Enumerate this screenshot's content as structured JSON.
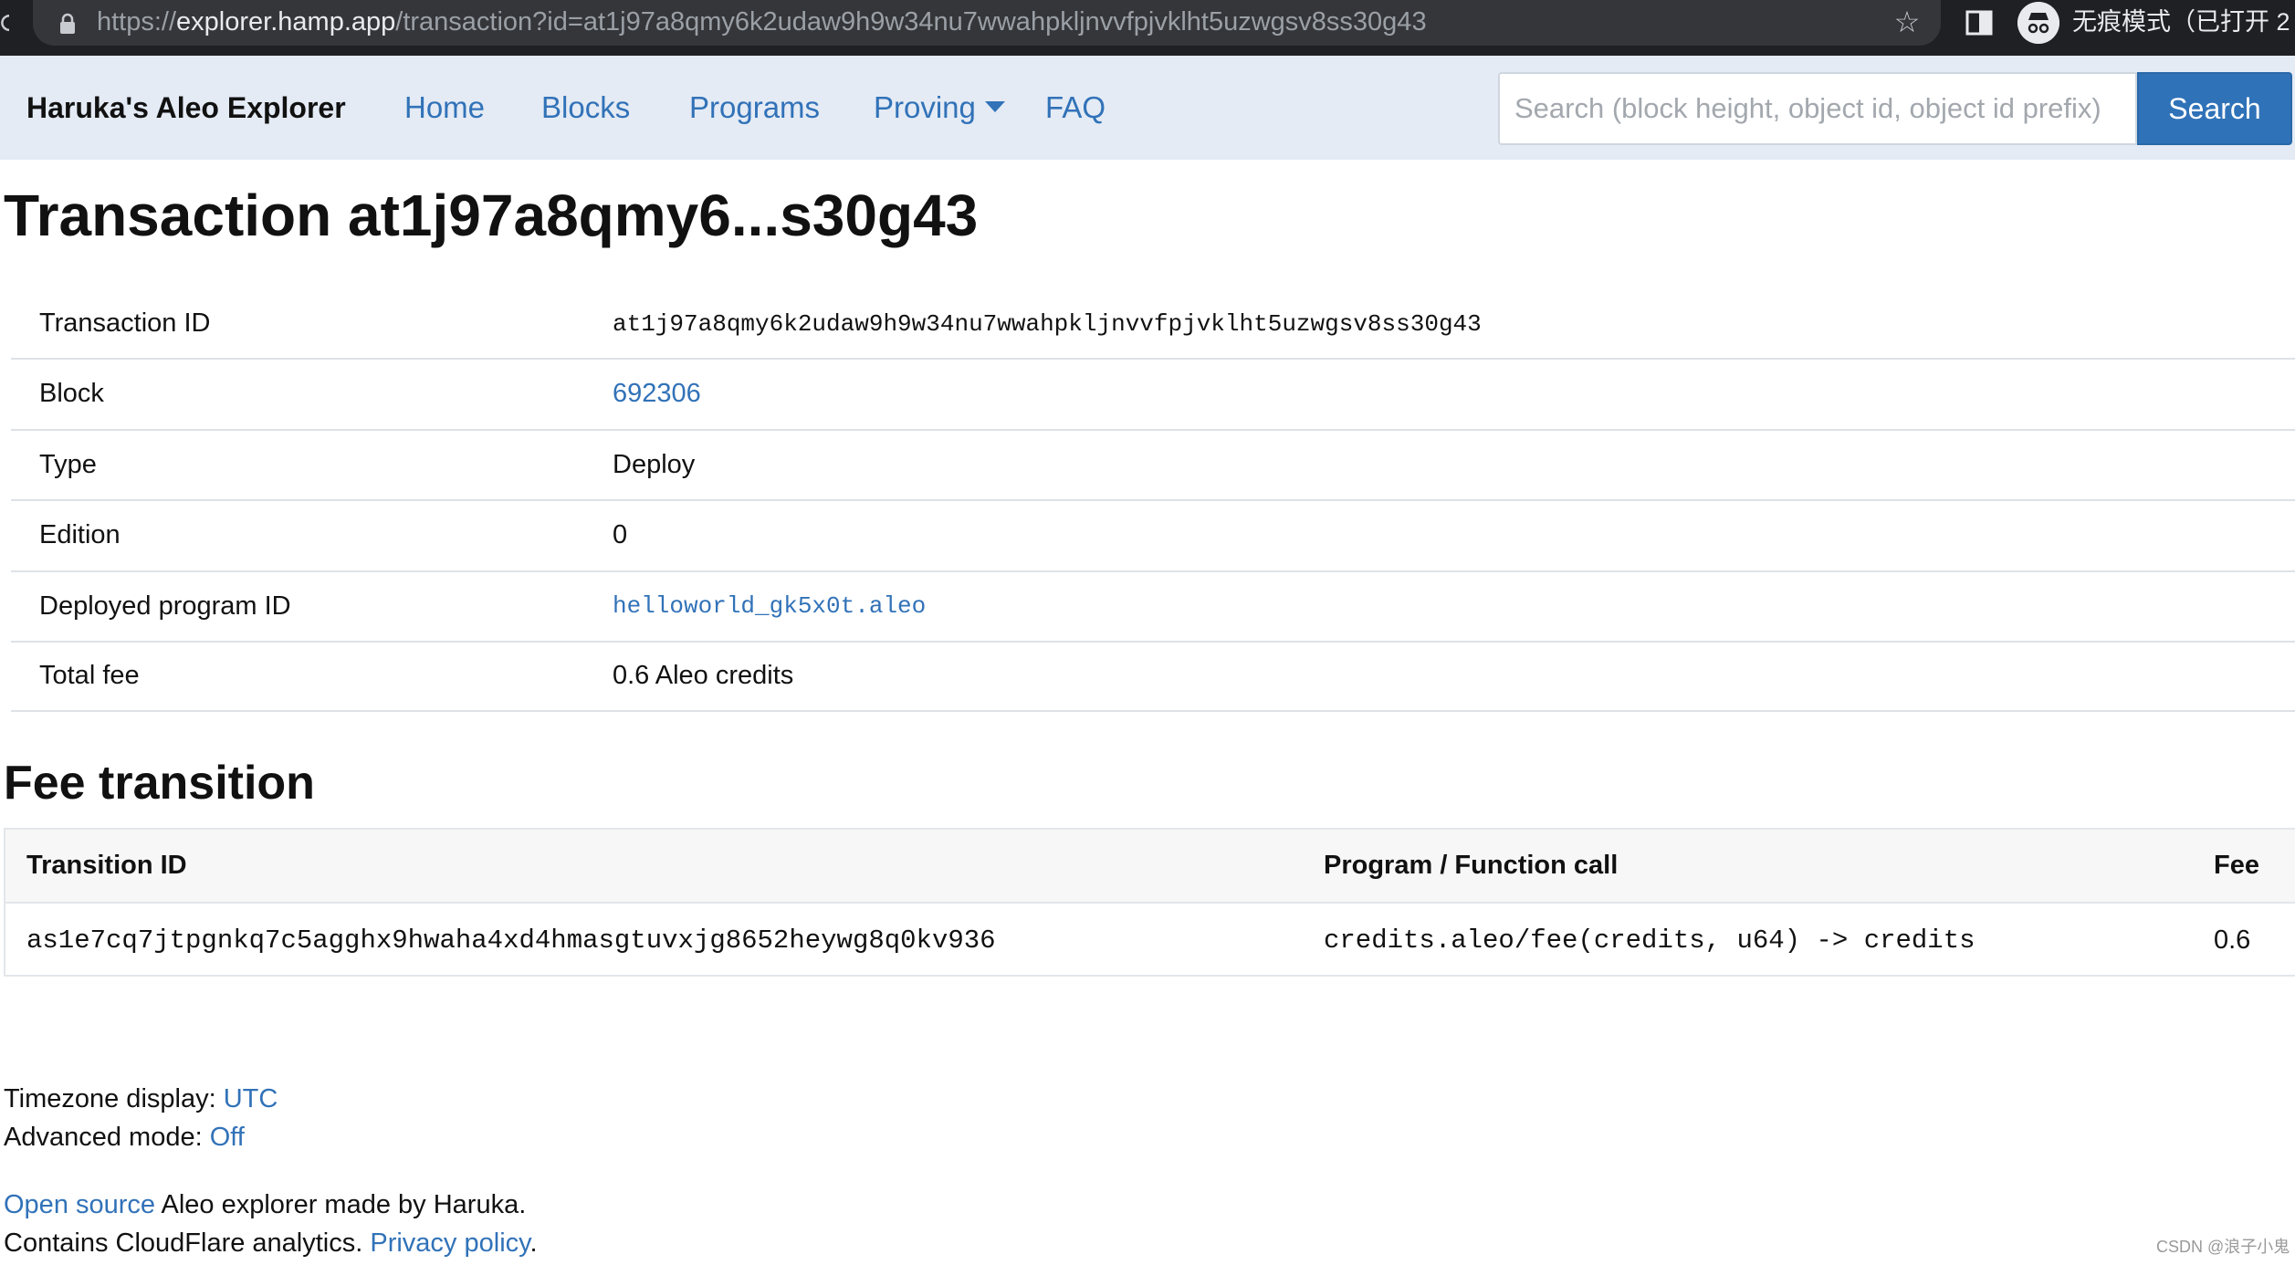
{
  "browser": {
    "url_scheme": "https://",
    "url_host": "explorer.hamp.app",
    "url_path": "/transaction?id=at1j97a8qmy6k2udaw9h9w34nu7wwahpkljnvvfpjvklht5uzwgsv8ss30g43",
    "incognito_label": "无痕模式（已打开 2"
  },
  "navbar": {
    "brand": "Haruka's Aleo Explorer",
    "links": {
      "home": "Home",
      "blocks": "Blocks",
      "programs": "Programs",
      "proving": "Proving",
      "faq": "FAQ"
    },
    "search_placeholder": "Search (block height, object id, object id prefix)",
    "search_button": "Search"
  },
  "page": {
    "title": "Transaction at1j97a8qmy6...s30g43"
  },
  "details": {
    "transaction_id_label": "Transaction ID",
    "transaction_id": "at1j97a8qmy6k2udaw9h9w34nu7wwahpkljnvvfpjvklht5uzwgsv8ss30g43",
    "block_label": "Block",
    "block": "692306",
    "type_label": "Type",
    "type": "Deploy",
    "edition_label": "Edition",
    "edition": "0",
    "program_label": "Deployed program ID",
    "program": "helloworld_gk5x0t.aleo",
    "fee_label": "Total fee",
    "fee": "0.6 Aleo credits"
  },
  "fee_transition": {
    "title": "Fee transition",
    "headers": {
      "transition_id": "Transition ID",
      "call": "Program / Function call",
      "fee": "Fee"
    },
    "rows": [
      {
        "transition_id": "as1e7cq7jtpgnkq7c5agghx9hwaha4xd4hmasgtuvxjg8652heywg8q0kv936",
        "call": "credits.aleo/fee(credits, u64) -> credits",
        "fee": "0.6"
      }
    ]
  },
  "footer": {
    "timezone_label": "Timezone display: ",
    "timezone_value": "UTC",
    "advanced_label": "Advanced mode: ",
    "advanced_value": "Off",
    "open_source_link": "Open source",
    "open_source_text": " Aleo explorer made by Haruka.",
    "analytics_text": "Contains CloudFlare analytics. ",
    "privacy_link": "Privacy policy",
    "privacy_period": "."
  },
  "watermark": "CSDN @浪子小鬼"
}
